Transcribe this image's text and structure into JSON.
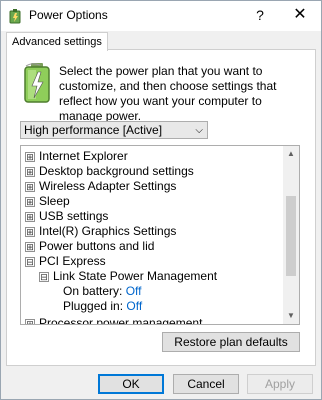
{
  "window": {
    "title": "Power Options",
    "help_label": "?",
    "close_label": "✕"
  },
  "tab": {
    "label": "Advanced settings"
  },
  "description": "Select the power plan that you want to customize, and then choose settings that reflect how you want your computer to manage power.",
  "plan_select": {
    "selected": "High performance [Active]"
  },
  "tree": {
    "items": [
      {
        "label": "Internet Explorer",
        "expander": "⊞"
      },
      {
        "label": "Desktop background settings",
        "expander": "⊞"
      },
      {
        "label": "Wireless Adapter Settings",
        "expander": "⊞"
      },
      {
        "label": "Sleep",
        "expander": "⊞"
      },
      {
        "label": "USB settings",
        "expander": "⊞"
      },
      {
        "label": "Intel(R) Graphics Settings",
        "expander": "⊞"
      },
      {
        "label": "Power buttons and lid",
        "expander": "⊞"
      },
      {
        "label": "PCI Express",
        "expander": "⊟"
      },
      {
        "label": "Link State Power Management",
        "expander": "⊟"
      },
      {
        "label": "On battery:",
        "value": "Off"
      },
      {
        "label": "Plugged in:",
        "value": "Off"
      },
      {
        "label": "Processor power management",
        "expander": "⊞"
      }
    ]
  },
  "buttons": {
    "restore": "Restore plan defaults",
    "ok": "OK",
    "cancel": "Cancel",
    "apply": "Apply"
  },
  "icons": {
    "app": "power-options-icon",
    "battery": "battery-plan-icon",
    "dropdown": "chevron-down-icon"
  },
  "colors": {
    "accent": "#0078d7",
    "link": "#0066cc"
  }
}
